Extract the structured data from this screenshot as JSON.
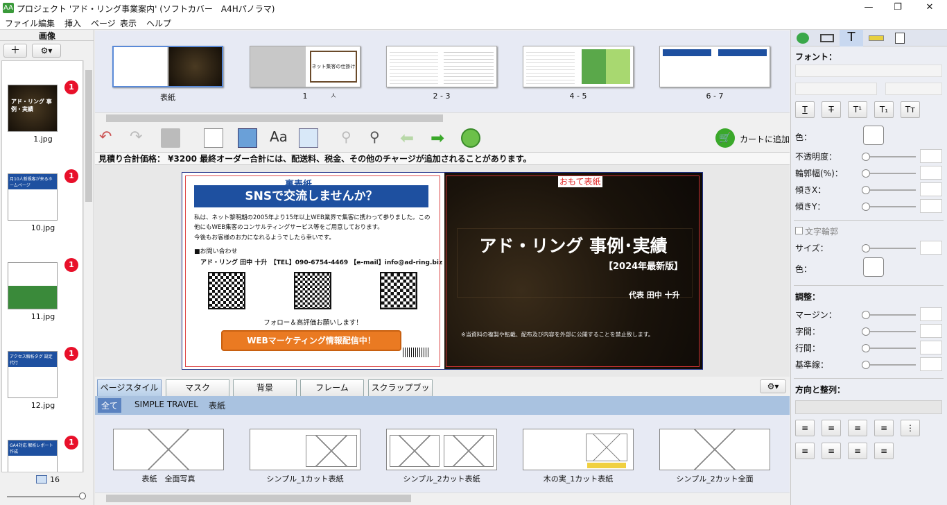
{
  "window": {
    "title": "プロジェクト 'アド・リング事業案内' (ソフトカバー　A4Hパノラマ)",
    "app_icon": "AA",
    "minimize": "—",
    "maximize": "❐",
    "close": "✕"
  },
  "menu": [
    "ファイル",
    "編集",
    "挿入",
    "ページ",
    "表示",
    "ヘルプ"
  ],
  "left_panel": {
    "title": "画像",
    "add_button": "＋",
    "settings_button": "⚙▾",
    "images": [
      {
        "label": "1.jpg",
        "badge": "1",
        "caption": "アド・リング 事例・実績"
      },
      {
        "label": "10.jpg",
        "badge": "1",
        "caption": "月10人新規客が来るホームページ"
      },
      {
        "label": "11.jpg",
        "badge": "1",
        "caption": ""
      },
      {
        "label": "12.jpg",
        "badge": "1",
        "caption": "アクセス解析タグ 設定代行"
      },
      {
        "label": "",
        "badge": "1",
        "caption": "GA4対応 解析レポート作成"
      }
    ],
    "count": "16"
  },
  "page_strip": {
    "pages": [
      "表紙",
      "1",
      "2 - 3",
      "4 - 5",
      "6 - 7"
    ],
    "page1_text": "ネット集客の仕掛け人"
  },
  "toolbar": {
    "add_to_cart": "カートに追加"
  },
  "price_bar": {
    "text": "見積り合計価格：  ¥3200    最終オーダー合計には、配送料、税金、その他のチャージが追加されることがあります。"
  },
  "spread": {
    "back_label": "裏表紙",
    "front_label": "おもて表紙",
    "back": {
      "heading": "SNSで交流しませんか？",
      "para1": "私は、ネット黎明期の2005年より15年以上WEB業界で集客に携わって参りました。この他にもWEB集客のコンサルティングサービス等をご用意しております。",
      "para2": "今後もお客様のお力になれるようでしたら幸いです。",
      "contact_head": "■お問い合わせ",
      "contact_line": "アド・リング 田中 十升　【TEL】090-6754-4469 【e-mail】info@ad-ring.biz",
      "follow": "フォロー＆高評価お願いします！",
      "cta": "WEBマーケティング情報配信中！"
    },
    "front": {
      "title": "アド・リング 事例･実績",
      "subtitle": "【2024年最新版】",
      "author": "代表 田中 十升",
      "notice": "※当資料の複製や転載、配布及び内容を外部に公開することを禁止致します。"
    }
  },
  "bottom_tabs": [
    "ページスタイル",
    "マスク",
    "背景",
    "フレーム",
    "スクラップブック"
  ],
  "filters": [
    "全て",
    "SIMPLE TRAVEL",
    "表紙"
  ],
  "templates": [
    "表紙　全面写真",
    "シンプル_1カット表紙",
    "シンプル_2カット表紙",
    "木の実_1カット表紙",
    "シンプル_2カット全面"
  ],
  "right_panel": {
    "font_label": "フォント：",
    "format_buttons": [
      "T",
      "T",
      "T¹",
      "T₁",
      "Tт"
    ],
    "color_label": "色：",
    "opacity_label": "不透明度：",
    "outline_width_label": "輪郭幅(%)：",
    "skew_x_label": "傾きX：",
    "skew_y_label": "傾きY：",
    "text_outline_label": "文字輪郭",
    "size_label": "サイズ：",
    "color2_label": "色：",
    "adjust_label": "調整：",
    "margin_label": "マージン：",
    "char_spacing_label": "字間：",
    "line_spacing_label": "行間：",
    "baseline_label": "基準線：",
    "direction_label": "方向と整列："
  }
}
